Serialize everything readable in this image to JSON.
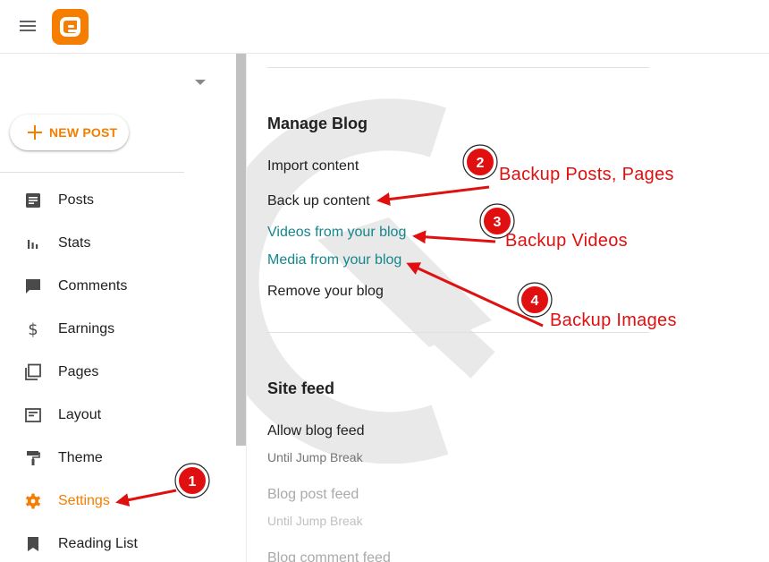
{
  "header": {
    "menu_icon": "hamburger-menu-icon",
    "logo_icon": "blogger-logo-icon",
    "brand_color": "#f57d00"
  },
  "sidebar": {
    "dropdown_icon": "caret-down-icon",
    "new_post_label": "NEW POST",
    "items": [
      {
        "label": "Posts",
        "icon": "posts-icon"
      },
      {
        "label": "Stats",
        "icon": "stats-icon"
      },
      {
        "label": "Comments",
        "icon": "comment-icon"
      },
      {
        "label": "Earnings",
        "icon": "dollar-icon"
      },
      {
        "label": "Pages",
        "icon": "pages-icon"
      },
      {
        "label": "Layout",
        "icon": "layout-icon"
      },
      {
        "label": "Theme",
        "icon": "paint-roller-icon"
      },
      {
        "label": "Settings",
        "icon": "gear-icon",
        "active": true
      },
      {
        "label": "Reading List",
        "icon": "bookmark-icon"
      }
    ]
  },
  "main": {
    "manage_blog": {
      "title": "Manage Blog",
      "items": [
        "Import content",
        "Back up content",
        "Videos from your blog",
        "Media from your blog",
        "Remove your blog"
      ]
    },
    "site_feed": {
      "title": "Site feed",
      "allow_blog_feed_label": "Allow blog feed",
      "allow_blog_feed_value": "Until Jump Break",
      "blog_post_feed_label": "Blog post feed",
      "blog_post_feed_value": "Until Jump Break",
      "blog_comment_feed_label": "Blog comment feed"
    },
    "link_color": "#14868c"
  },
  "annotations": {
    "color": "#e01010",
    "callouts": [
      {
        "number": "1",
        "text": ""
      },
      {
        "number": "2",
        "text": "Backup Posts, Pages"
      },
      {
        "number": "3",
        "text": "Backup Videos"
      },
      {
        "number": "4",
        "text": "Backup Images"
      }
    ]
  }
}
